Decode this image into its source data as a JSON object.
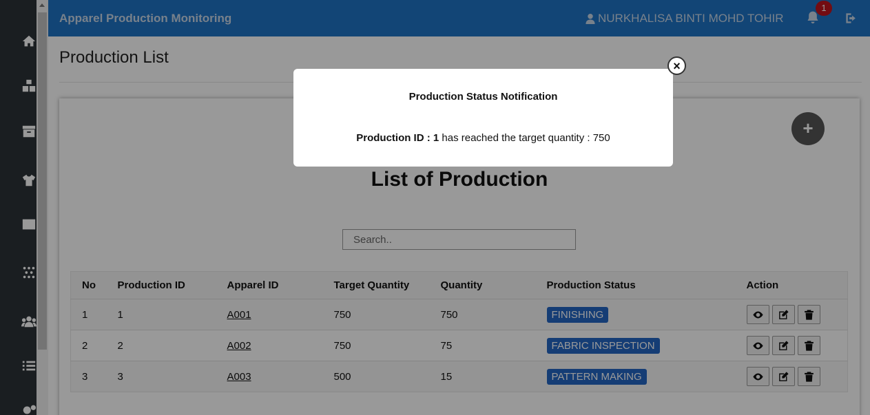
{
  "header": {
    "app_title": "Apparel Production Monitoring",
    "user_name": "NURKHALISA BINTI MOHD TOHIR",
    "notification_count": "1"
  },
  "sidebar": {
    "icons": [
      "home-icon",
      "boxes-icon",
      "archive-icon",
      "tshirt-icon",
      "fabric-icon",
      "dots-pattern-icon",
      "users-icon",
      "list-icon",
      "gears-icon"
    ]
  },
  "page": {
    "title": "Production List",
    "list_heading": "List of Production",
    "add_label": "+",
    "search_placeholder": "Search.."
  },
  "table": {
    "headers": [
      "No",
      "Production ID",
      "Apparel ID",
      "Target Quantity",
      "Quantity",
      "Production Status",
      "Action"
    ],
    "rows": [
      {
        "no": "1",
        "production_id": "1",
        "apparel_id": "A001",
        "target": "750",
        "quantity": "750",
        "status": "FINISHING"
      },
      {
        "no": "2",
        "production_id": "2",
        "apparel_id": "A002",
        "target": "750",
        "quantity": "75",
        "status": "FABRIC INSPECTION"
      },
      {
        "no": "3",
        "production_id": "3",
        "apparel_id": "A003",
        "target": "500",
        "quantity": "15",
        "status": "PATTERN MAKING"
      }
    ]
  },
  "modal": {
    "title": "Production Status Notification",
    "msg_prefix": "Production ID : 1",
    "msg_suffix": " has reached the target quantity : 750",
    "close_label": "×"
  },
  "colors": {
    "header_bg": "#1e73c5",
    "sidebar_bg": "#2c3238",
    "status_badge": "#2466c4",
    "notification_badge": "#c0141e"
  }
}
